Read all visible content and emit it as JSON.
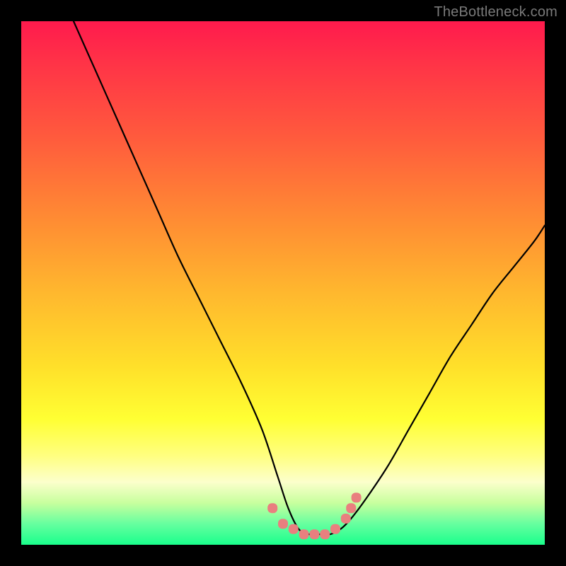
{
  "watermark": "TheBottleneck.com",
  "chart_data": {
    "type": "line",
    "title": "",
    "xlabel": "",
    "ylabel": "",
    "xlim": [
      0,
      100
    ],
    "ylim": [
      0,
      100
    ],
    "grid": false,
    "legend": false,
    "description": "Bottleneck curve: high on left, descends to near-zero around x≈52–60, then rises again toward the right edge. Background is a vertical red→yellow→green heat gradient where green (bottom) = good / low bottleneck.",
    "series": [
      {
        "name": "bottleneck-curve",
        "color": "#000000",
        "x": [
          10,
          14,
          18,
          22,
          26,
          30,
          34,
          38,
          42,
          46,
          49,
          51,
          53,
          55,
          57,
          59,
          61,
          63,
          66,
          70,
          74,
          78,
          82,
          86,
          90,
          94,
          98,
          100
        ],
        "values": [
          100,
          91,
          82,
          73,
          64,
          55,
          47,
          39,
          31,
          22,
          13,
          7,
          3,
          2,
          2,
          2,
          3,
          5,
          9,
          15,
          22,
          29,
          36,
          42,
          48,
          53,
          58,
          61
        ]
      },
      {
        "name": "bottom-markers",
        "color": "#e97f7f",
        "type": "scatter",
        "x": [
          48,
          50,
          52,
          54,
          56,
          58,
          60,
          62,
          63,
          64
        ],
        "values": [
          7,
          4,
          3,
          2,
          2,
          2,
          3,
          5,
          7,
          9
        ]
      }
    ]
  }
}
